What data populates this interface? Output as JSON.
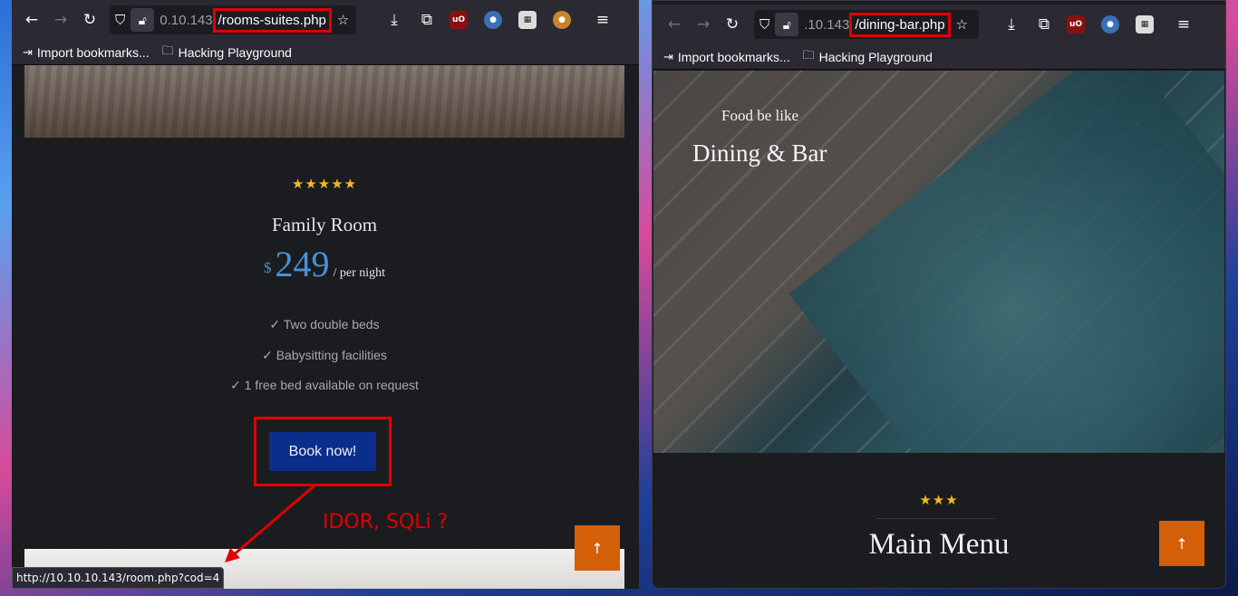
{
  "left_window": {
    "url_host": "0.10.143",
    "url_path": "/rooms-suites.php",
    "bookmarks": [
      "Import bookmarks...",
      "Hacking Playground"
    ],
    "room": {
      "stars": "★★★★★",
      "title": "Family Room",
      "currency": "$",
      "price": "249",
      "per": "/ per night",
      "features": [
        "✓ Two double beds",
        "✓ Babysitting facilities",
        "✓ 1 free bed available on request"
      ],
      "book_label": "Book now!"
    },
    "scroll_top_label": "↑",
    "status_url": "http://10.10.10.143/room.php?cod=4"
  },
  "annotation": {
    "text": "IDOR, SQLi ?",
    "color": "#e00000"
  },
  "right_window": {
    "url_host": ".10.143",
    "url_path": "/dining-bar.php",
    "bookmarks": [
      "Import bookmarks...",
      "Hacking Playground"
    ],
    "hero_subtitle": "Food be like",
    "hero_title": "Dining & Bar",
    "menu_stars": "★★★",
    "menu_title": "Main Menu",
    "scroll_top_label": "↑"
  },
  "icons": {
    "back": "back-arrow-icon",
    "forward": "forward-arrow-icon",
    "reload": "reload-icon",
    "shield": "shield-icon",
    "lock": "lock-icon",
    "star": "bookmark-star-icon",
    "download": "download-icon",
    "extensions": "puzzle-icon",
    "ublock": "ublock-icon",
    "menu": "hamburger-menu-icon",
    "import": "import-icon",
    "folder": "folder-icon"
  },
  "colors": {
    "accent_blue": "#4a90d9",
    "button_blue": "#0b2e8c",
    "scroll_orange": "#d35f09",
    "star_gold": "#f5b623"
  }
}
